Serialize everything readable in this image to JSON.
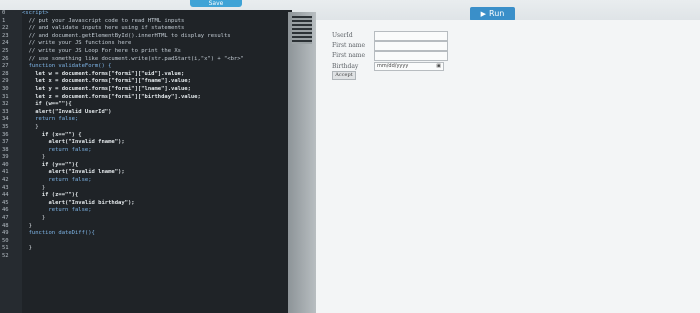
{
  "toolbar": {
    "save_label": "Save",
    "run_label": "Run",
    "run_icon": "play-icon"
  },
  "editor": {
    "line_numbers": [
      "0",
      "1",
      "22",
      "23",
      "24",
      "25",
      "26",
      "27",
      "28",
      "29",
      "30",
      "31",
      "32",
      "33",
      "34",
      "35",
      "36",
      "37",
      "38",
      "39",
      "40",
      "41",
      "42",
      "43",
      "44",
      "45",
      "46",
      "47",
      "48",
      "49",
      "50",
      "51",
      "52"
    ],
    "lines": [
      "<script>",
      "  // put your Javascript code to read HTML inputs",
      "  // and validate inputs here using if statements",
      "  // and document.getElementById().innerHTML to display results",
      "  // write your JS functions here",
      "  // write your JS Loop For here to print the Xs",
      "  // use something like document.write(str.padStart(i,\"x\") + \"<br>\"",
      "  function validateForm() {",
      "    let w = document.forms[\"formi\"][\"uid\"].value;",
      "    let x = document.forms[\"formi\"][\"fname\"].value;",
      "    let y = document.forms[\"formi\"][\"lname\"].value;",
      "    let z = document.forms[\"formi\"][\"birthday\"].value;",
      "    if (w==\"\"){",
      "    alert(\"Invalid UserId\")",
      "    return false;",
      "    }",
      "      if (x==\"\") {",
      "        alert(\"Invalid fname\");",
      "        return false;",
      "      }",
      "      if (y==\"\"){",
      "        alert(\"Invalid lname\");",
      "        return false;",
      "      }",
      "      if (z==\"\"){",
      "        alert(\"Invalid birthday\");",
      "        return false;",
      "      }",
      "  }",
      "  function dateDiff(){",
      "",
      "  }",
      ""
    ]
  },
  "preview": {
    "fields": [
      {
        "label": "UserId",
        "value": ""
      },
      {
        "label": "First name",
        "value": ""
      },
      {
        "label": "First name",
        "value": ""
      }
    ],
    "birthday_label": "Birthday",
    "date_placeholder": "mm/dd/yyyy",
    "accept_label": "Accept"
  }
}
